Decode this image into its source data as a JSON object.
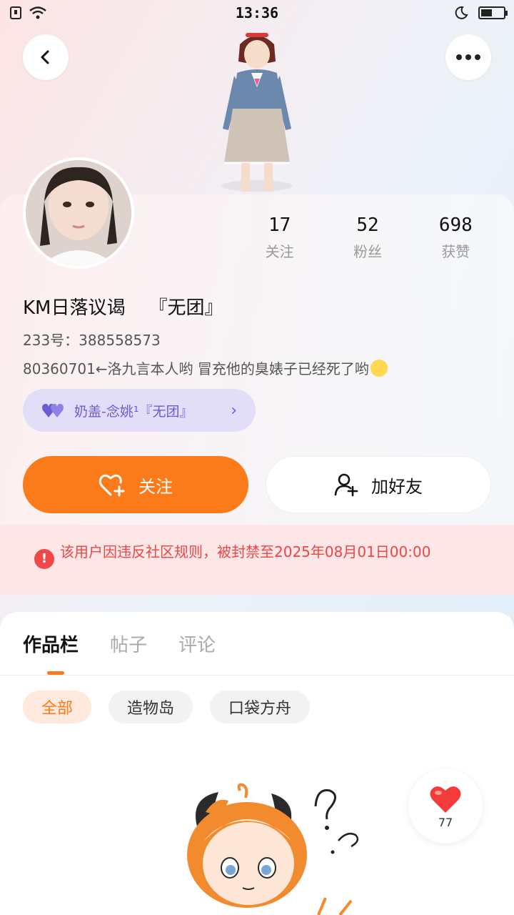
{
  "status_bar": {
    "time": "13:36",
    "battery_level": 0.5,
    "icons": [
      "sim-icon",
      "wifi-icon",
      "moon-icon",
      "battery-icon"
    ]
  },
  "header": {
    "back_icon": "chevron-left-icon",
    "more_icon": "more-dots-icon"
  },
  "profile": {
    "username": "KM日落议谒    『无团』",
    "uid": "233号：388558573",
    "bio": "80360701←洛九言本人哟 冒充他的臭婊子已经死了哟",
    "relation": {
      "label": "奶盖-念姚¹『无团』"
    },
    "stats": [
      {
        "value": "17",
        "label": "关注"
      },
      {
        "value": "52",
        "label": "粉丝"
      },
      {
        "value": "698",
        "label": "获赞"
      }
    ]
  },
  "actions": {
    "follow_label": "关注",
    "add_friend_label": "加好友"
  },
  "ban_notice": "该用户因违反社区规则，被封禁至2025年08月01日00:00",
  "tabs": [
    {
      "label": "作品栏",
      "active": true
    },
    {
      "label": "帖子",
      "active": false
    },
    {
      "label": "评论",
      "active": false
    }
  ],
  "filters": [
    {
      "label": "全部",
      "active": true
    },
    {
      "label": "造物岛",
      "active": false
    },
    {
      "label": "口袋方舟",
      "active": false
    }
  ],
  "floating_like": {
    "count": "77"
  },
  "colors": {
    "accent": "#fb7a1a",
    "ban_text": "#ec4646",
    "ban_bg": "#fde6e6",
    "relation_bg": "#e3def7",
    "relation_text": "#6b5bd6"
  }
}
